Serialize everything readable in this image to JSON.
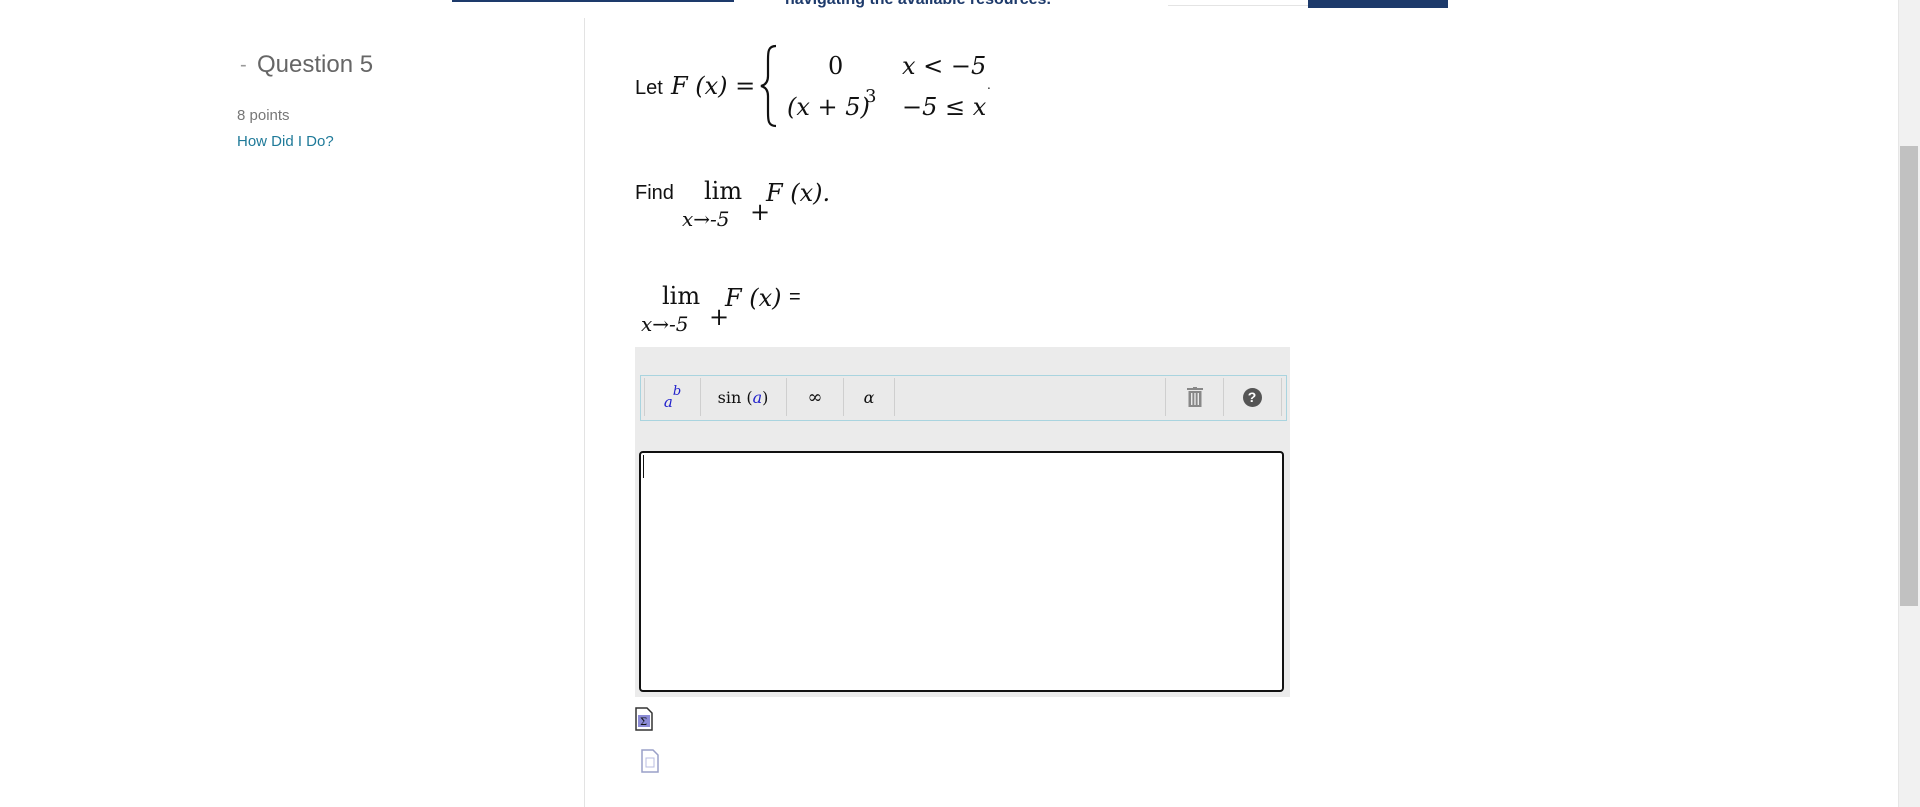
{
  "top": {
    "banner_text": "navigating the available resources."
  },
  "question": {
    "dash": "-",
    "title": "Question 5",
    "points": "8 points",
    "how_link": "How Did I Do?"
  },
  "problem": {
    "let": "Let",
    "F_of_x": "F (x) =",
    "case1_value": "0",
    "case1_condition": "x < −5",
    "case2_value": "(x + 5)",
    "case2_exponent": "3",
    "case2_condition": "−5 ≤ x",
    "trailing_dot": ".",
    "find": "Find",
    "lim": "lim",
    "lim_sub": "x→-5",
    "plus": "+",
    "find_expr": "F (x).",
    "answer_expr": "F (x)",
    "equals": "="
  },
  "toolbar": {
    "power_base": "a",
    "power_exp": "b",
    "sin_label": "sin",
    "sin_arg": "a",
    "infinity": "∞",
    "alpha": "α",
    "help": "?"
  },
  "colors": {
    "brand_navy": "#1d3a6b",
    "link": "#1f7a99",
    "toolbar_border": "#a9d4df"
  }
}
